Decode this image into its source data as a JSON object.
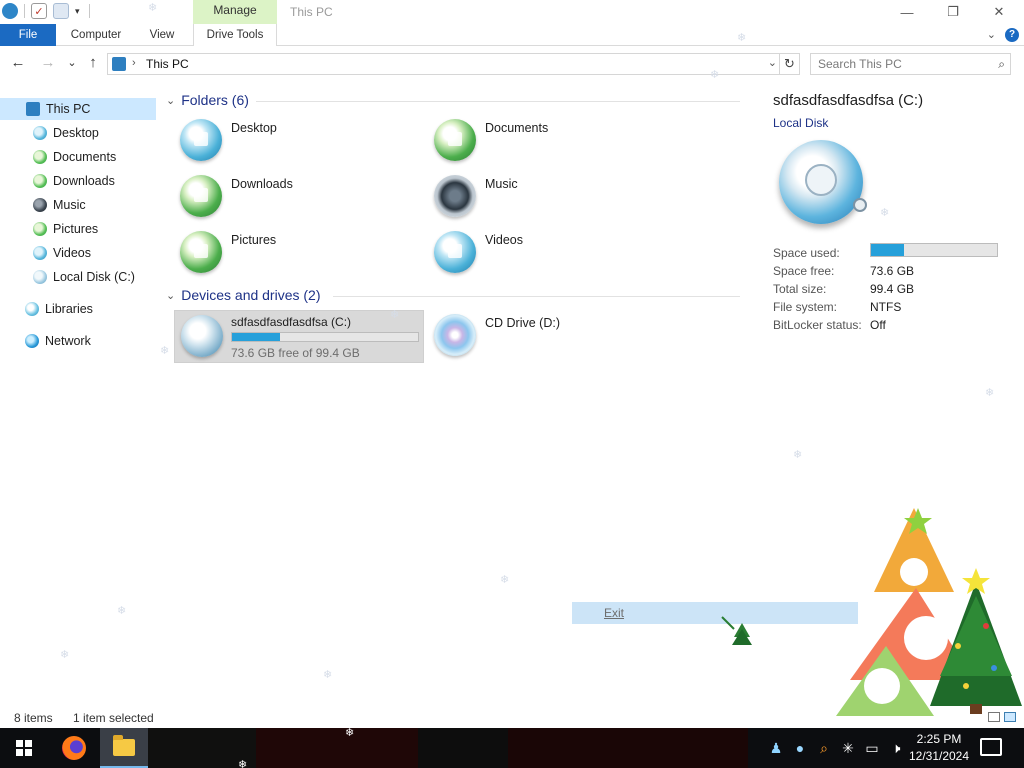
{
  "quick_access": {
    "customize_caret": "▾"
  },
  "ribbon": {
    "context_tab_label": "Manage",
    "window_title": "This PC",
    "tabs": [
      {
        "label": "File"
      },
      {
        "label": "Computer"
      },
      {
        "label": "View"
      },
      {
        "label": "Drive Tools"
      }
    ]
  },
  "window_controls": {
    "minimize": "—",
    "maximize": "❐",
    "close": "✕",
    "help": "?"
  },
  "address": {
    "back": "←",
    "forward": "→",
    "recent": "⌄",
    "up": "↑",
    "crumbs": [
      "This PC"
    ],
    "separator": "›",
    "refresh": "↻"
  },
  "search": {
    "placeholder": "Search This PC"
  },
  "navigation": {
    "items": [
      {
        "label": "This PC",
        "icon": "pc-icon",
        "selected": true
      },
      {
        "label": "Desktop",
        "icon": "desktop-folder-icon"
      },
      {
        "label": "Documents",
        "icon": "documents-folder-icon"
      },
      {
        "label": "Downloads",
        "icon": "downloads-folder-icon"
      },
      {
        "label": "Music",
        "icon": "music-folder-icon"
      },
      {
        "label": "Pictures",
        "icon": "pictures-folder-icon"
      },
      {
        "label": "Videos",
        "icon": "videos-folder-icon"
      },
      {
        "label": "Local Disk (C:)",
        "icon": "local-disk-icon"
      },
      {
        "label": "Libraries",
        "icon": "libraries-icon"
      },
      {
        "label": "Network",
        "icon": "network-icon"
      }
    ]
  },
  "folders": {
    "header": "Folders (6)",
    "items": [
      {
        "label": "Desktop",
        "icon": "desktop-folder-icon"
      },
      {
        "label": "Documents",
        "icon": "documents-folder-icon"
      },
      {
        "label": "Downloads",
        "icon": "downloads-folder-icon"
      },
      {
        "label": "Music",
        "icon": "music-folder-icon"
      },
      {
        "label": "Pictures",
        "icon": "pictures-folder-icon"
      },
      {
        "label": "Videos",
        "icon": "videos-folder-icon"
      }
    ]
  },
  "devices": {
    "header": "Devices and drives (2)",
    "drive_c": {
      "name": "sdfasdfasdfasdfsa (C:)",
      "free_text": "73.6 GB free of 99.4 GB",
      "used_fraction": 0.26
    },
    "cd_drive": {
      "name": "CD Drive (D:)"
    }
  },
  "details": {
    "title": "sdfasdfasdfasdfsa (C:)",
    "subtitle": "Local Disk",
    "space_used_label": "Space used:",
    "used_fraction": 0.26,
    "props": [
      {
        "label": "Space free:",
        "value": "73.6 GB"
      },
      {
        "label": "Total size:",
        "value": "99.4 GB"
      },
      {
        "label": "File system:",
        "value": "NTFS"
      },
      {
        "label": "BitLocker status:",
        "value": "Off"
      }
    ]
  },
  "status": {
    "items_count": "8 items",
    "selected": "1 item selected"
  },
  "popup": {
    "exit_label": "Exit"
  },
  "taskbar": {
    "apps": [
      {
        "name": "firefox-icon"
      },
      {
        "name": "file-explorer-icon",
        "active": true
      }
    ],
    "tray_icons": [
      "people-icon",
      "water-drop-icon",
      "search-tool-icon",
      "sparkle-icon",
      "network-icon",
      "volume-muted-icon"
    ],
    "time": "2:25 PM",
    "date": "12/31/2024"
  },
  "colors": {
    "accent": "#1b6ac2",
    "selection": "#cce8ff",
    "context_tab": "#dcf3c6",
    "progress": "#26a0da",
    "group_header": "#1e3287"
  }
}
